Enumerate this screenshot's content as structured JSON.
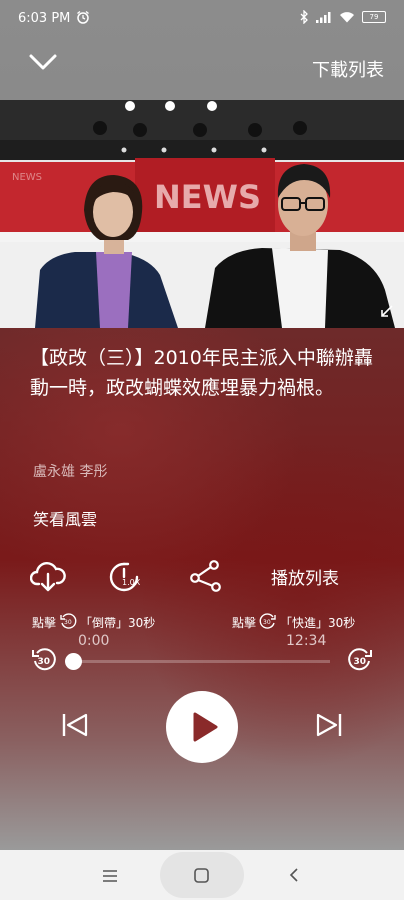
{
  "status_bar": {
    "time": "6:03 PM",
    "battery": "79"
  },
  "header": {
    "download_list_label": "下載列表"
  },
  "video": {
    "backdrop_text": "NEWS",
    "backdrop_small_text": "NEWS"
  },
  "episode": {
    "title": "【政改（三）】2010年民主派入中聯辦轟動一時，政改蝴蝶效應埋暴力禍根。",
    "authors": "盧永雄 李彤",
    "program": "笑看風雲"
  },
  "actions": {
    "speed_label": "1.0X",
    "playlist_label": "播放列表"
  },
  "hints": {
    "rewind_prefix": "點擊",
    "rewind_text": "「倒帶」30秒",
    "forward_prefix": "點擊",
    "forward_text": "「快進」30秒",
    "badge_seconds": "30"
  },
  "progress": {
    "current_time": "0:00",
    "duration": "12:34",
    "fraction": 0
  }
}
